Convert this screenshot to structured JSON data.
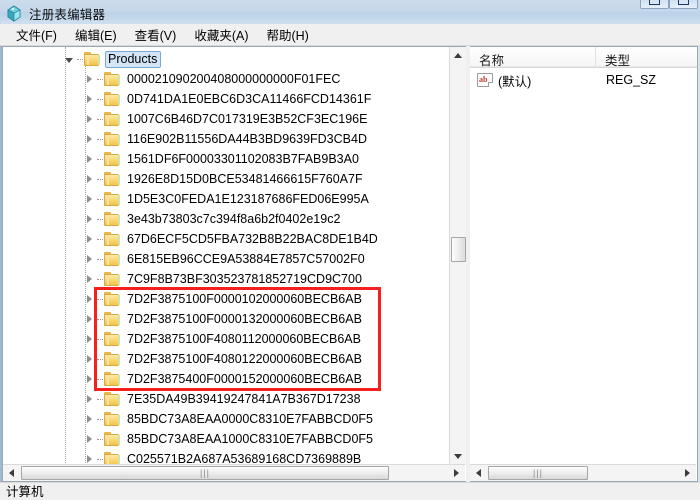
{
  "window": {
    "title": "注册表编辑器",
    "icon": "registry-editor-icon",
    "buttons": [
      {
        "name": "minimize-button",
        "glyph": "minimize"
      },
      {
        "name": "maximize-button",
        "glyph": "maximize"
      }
    ]
  },
  "menubar": {
    "items": [
      {
        "label": "文件(F)",
        "name": "menu-file"
      },
      {
        "label": "编辑(E)",
        "name": "menu-edit"
      },
      {
        "label": "查看(V)",
        "name": "menu-view"
      },
      {
        "label": "收藏夹(A)",
        "name": "menu-favorites"
      },
      {
        "label": "帮助(H)",
        "name": "menu-help"
      }
    ]
  },
  "tree": {
    "root": {
      "label": "Products",
      "selected": true,
      "expanded": true
    },
    "children": [
      {
        "label": "000021090200408000000000F01FEC",
        "highlighted": false
      },
      {
        "label": "0D741DA1E0EBC6D3CA11466FCD14361F",
        "highlighted": false
      },
      {
        "label": "1007C6B46D7C017319E3B52CF3EC196E",
        "highlighted": false
      },
      {
        "label": "116E902B11556DA44B3BD9639FD3CB4D",
        "highlighted": false
      },
      {
        "label": "1561DF6F00003301102083B7FAB9B3A0",
        "highlighted": false
      },
      {
        "label": "1926E8D15D0BCE53481466615F760A7F",
        "highlighted": false
      },
      {
        "label": "1D5E3C0FEDA1E123187686FED06E995A",
        "highlighted": false
      },
      {
        "label": "3e43b73803c7c394f8a6b2f0402e19c2",
        "highlighted": false
      },
      {
        "label": "67D6ECF5CD5FBA732B8B22BAC8DE1B4D",
        "highlighted": false
      },
      {
        "label": "6E815EB96CCE9A53884E7857C57002F0",
        "highlighted": false
      },
      {
        "label": "7C9F8B73BF303523781852719CD9C700",
        "highlighted": false
      },
      {
        "label": "7D2F3875100F0000102000060BECB6AB",
        "highlighted": true
      },
      {
        "label": "7D2F3875100F0000132000060BECB6AB",
        "highlighted": true
      },
      {
        "label": "7D2F3875100F4080112000060BECB6AB",
        "highlighted": true
      },
      {
        "label": "7D2F3875100F4080122000060BECB6AB",
        "highlighted": true
      },
      {
        "label": "7D2F3875400F0000152000060BECB6AB",
        "highlighted": true
      },
      {
        "label": "7E35DA49B39419247841A7B367D17238",
        "highlighted": false
      },
      {
        "label": "85BDC73A8EAA0000C8310E7FABBCD0F5",
        "highlighted": false
      },
      {
        "label": "85BDC73A8EAA1000C8310E7FABBCD0F5",
        "highlighted": false
      },
      {
        "label": "C025571B2A687A53689168CD7369889B",
        "highlighted": false
      }
    ],
    "annotation": {
      "name": "red-highlight-box",
      "color": "#f51f1f",
      "encloses_count": 5
    },
    "scrollbars": {
      "vertical_thumb_label": "tree-vertical-scroll-thumb",
      "horizontal_thumb_label": "tree-horizontal-scroll-thumb"
    }
  },
  "values": {
    "columns": [
      {
        "label": "名称",
        "name": "column-header-name"
      },
      {
        "label": "类型",
        "name": "column-header-type"
      }
    ],
    "rows": [
      {
        "icon": "string-value-icon",
        "name": "(默认)",
        "type": "REG_SZ"
      }
    ]
  },
  "statusbar": {
    "text": "计算机"
  }
}
